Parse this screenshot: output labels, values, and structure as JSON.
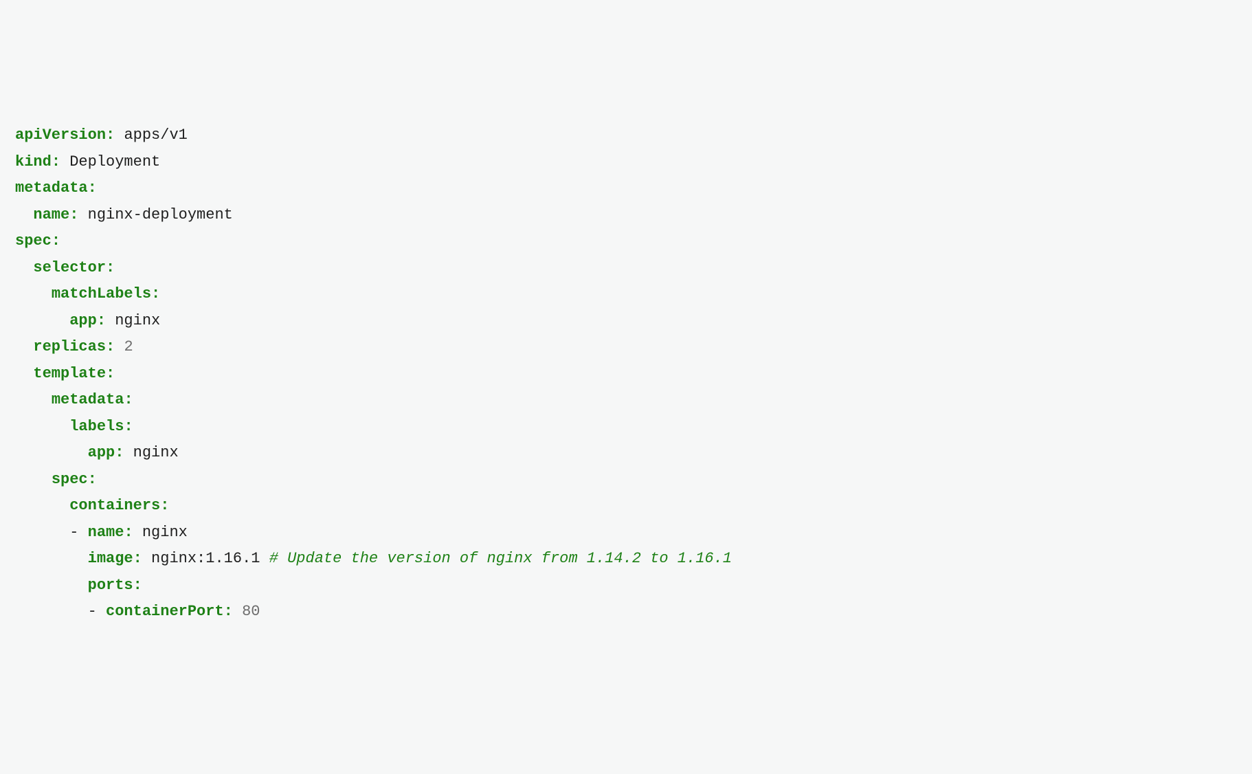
{
  "yaml": {
    "apiVersion": {
      "key": "apiVersion",
      "value": "apps/v1"
    },
    "kind": {
      "key": "kind",
      "value": "Deployment"
    },
    "metadata": {
      "key": "metadata",
      "name": {
        "key": "name",
        "value": "nginx-deployment"
      }
    },
    "spec": {
      "key": "spec",
      "selector": {
        "key": "selector",
        "matchLabels": {
          "key": "matchLabels",
          "app": {
            "key": "app",
            "value": "nginx"
          }
        }
      },
      "replicas": {
        "key": "replicas",
        "value": "2"
      },
      "template": {
        "key": "template",
        "metadata": {
          "key": "metadata",
          "labels": {
            "key": "labels",
            "app": {
              "key": "app",
              "value": "nginx"
            }
          }
        },
        "spec": {
          "key": "spec",
          "containers": {
            "key": "containers",
            "item": {
              "dash": "-",
              "name": {
                "key": "name",
                "value": "nginx"
              },
              "image": {
                "key": "image",
                "value": "nginx:1.16.1",
                "comment": "# Update the version of nginx from 1.14.2 to 1.16.1"
              },
              "ports": {
                "key": "ports",
                "item": {
                  "dash": "-",
                  "containerPort": {
                    "key": "containerPort",
                    "value": "80"
                  }
                }
              }
            }
          }
        }
      }
    }
  }
}
